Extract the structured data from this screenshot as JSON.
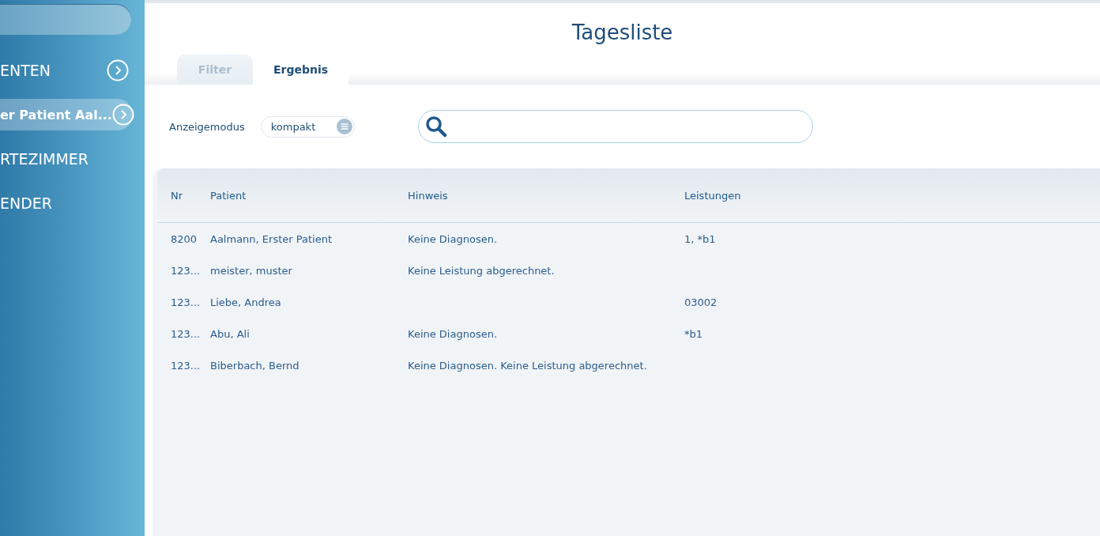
{
  "sidebar": {
    "items": [
      {
        "label": "ENTEN",
        "arrow": true,
        "selected": false
      },
      {
        "label": "er Patient Aal...",
        "arrow": true,
        "selected": true
      },
      {
        "label": "RTEZIMMER",
        "arrow": false,
        "selected": false
      },
      {
        "label": "ENDER",
        "arrow": false,
        "selected": false
      }
    ]
  },
  "title": "Tagesliste",
  "tabs": [
    {
      "label": "Filter",
      "selected": false
    },
    {
      "label": "Ergebnis",
      "selected": true
    }
  ],
  "display_mode": {
    "label": "Anzeigemodus",
    "value": "kompakt"
  },
  "table": {
    "columns": [
      "Nr",
      "Patient",
      "Hinweis",
      "Leistungen"
    ],
    "rows": [
      [
        "8200",
        "Aalmann, Erster Patient",
        "Keine Diagnosen.",
        "1, *b1"
      ],
      [
        "123...",
        "meister, muster",
        "Keine Leistung abgerechnet.",
        ""
      ],
      [
        "123...",
        "Liebe, Andrea",
        "",
        "03002"
      ],
      [
        "123...",
        "Abu, Ali",
        "Keine Diagnosen.",
        "*b1"
      ],
      [
        "123...",
        "Biberbach, Bernd",
        "Keine Diagnosen. Keine Leistung abgerechnet.",
        ""
      ]
    ]
  }
}
